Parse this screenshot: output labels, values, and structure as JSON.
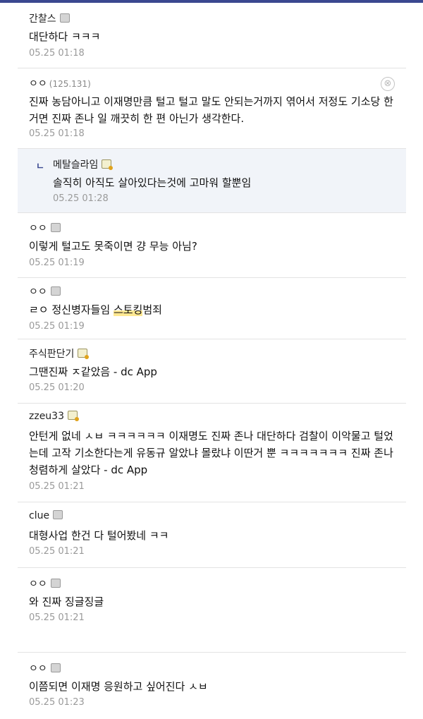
{
  "comments": [
    {
      "nick": "간찰스",
      "ip": "",
      "memo": "normal",
      "text": "대단하다 ㅋㅋㅋ",
      "date": "05.25 01:18"
    },
    {
      "nick": "ㅇㅇ",
      "ip": "(125.131)",
      "memo": "",
      "text": "진짜 농담아니고 이재명만큼 털고 털고 말도 안되는거까지 엮어서 저정도 기소당 한거면 진짜 존나 일 깨끗히 한 편 아닌가 생각한다.",
      "date": "05.25 01:18",
      "delete_icon": "⊗"
    },
    {
      "reply_mark": "ㄴ",
      "nick": "메탈슬라임",
      "memo": "fixed",
      "text": "솔직히 아직도 살아있다는것에 고마워 할뿐임",
      "date": "05.25 01:28"
    },
    {
      "nick": "ㅇㅇ",
      "memo": "normal",
      "text": "이렇게 털고도 못죽이면 걍 무능 아님?",
      "date": "05.25 01:19"
    },
    {
      "nick": "ㅇㅇ",
      "memo": "normal",
      "text_pre": "ㄹㅇ 정신병자들임 ",
      "text_hl": "스토킹",
      "text_post": "범죄",
      "date": "05.25 01:19"
    },
    {
      "nick": "주식판단기",
      "memo": "fixed",
      "text": "그땐진짜 ㅈ같았음 - dc App",
      "date": "05.25 01:20"
    },
    {
      "nick": "zzeu33",
      "memo": "fixed",
      "text": "안턴게 없네 ㅅㅂ ㅋㅋㅋㅋㅋㅋ 이재명도 진짜 존나 대단하다 검찰이 이악물고 털었는데 고작 기소한다는게 유동규 알았냐 몰랐냐 이딴거 뿐 ㅋㅋㅋㅋㅋㅋㅋ 진짜 존나 청렴하게 살았다 - dc App",
      "date": "05.25 01:21"
    },
    {
      "nick": "clue",
      "memo": "normal",
      "text": "대형사업 한건 다 털어봤네 ㅋㅋ",
      "date": "05.25 01:21"
    },
    {
      "nick": "ㅇㅇ",
      "memo": "normal",
      "text": "와 진짜 징글징글",
      "date": "05.25 01:21"
    },
    {
      "nick": "ㅇㅇ",
      "memo": "normal",
      "text": "이쯤되면 이재명 응원하고 싶어진다 ㅅㅂ",
      "date": "05.25 01:23"
    }
  ]
}
